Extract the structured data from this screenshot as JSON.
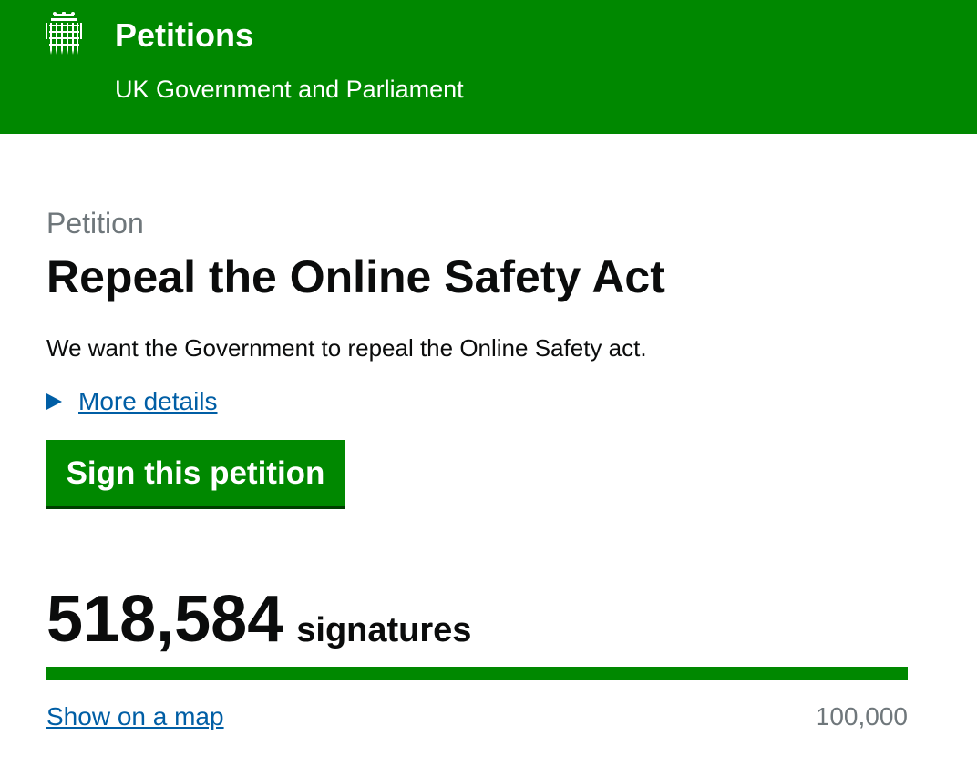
{
  "header": {
    "logo_icon": "portcullis-icon",
    "title": "Petitions",
    "subtitle": "UK Government and Parliament",
    "background_color": "#008800"
  },
  "petition": {
    "caption": "Petition",
    "title": "Repeal the Online Safety Act",
    "action": "We want the Government to repeal the Online Safety act.",
    "more_details_label": "More details",
    "sign_button_label": "Sign this petition"
  },
  "signatures": {
    "count": "518,584",
    "label": "signatures",
    "threshold": "100,000",
    "progress_fraction": 1.0,
    "map_link_label": "Show on a map"
  },
  "colors": {
    "brand_green": "#008800",
    "link_blue": "#005ea5",
    "secondary_text": "#6f777b"
  }
}
